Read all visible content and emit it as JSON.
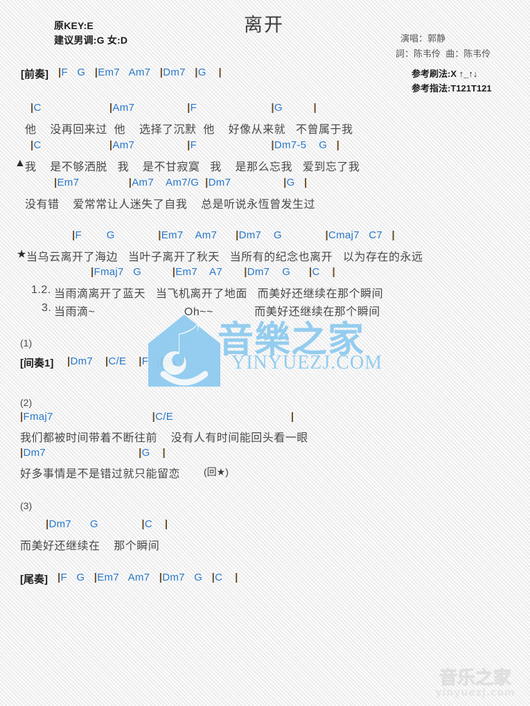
{
  "document": {
    "title": "离开",
    "key_info": {
      "original_key": "原KEY:E",
      "suggested_key": "建议男调:G 女:D"
    },
    "credits": {
      "singer": "演唱：郭静",
      "writers": "詞：陈韦伶  曲：陈韦伶"
    },
    "play_info": {
      "strum": "参考刷法:X ↑_↑↓",
      "fingering": "参考指法:T121T121"
    }
  },
  "sections": {
    "intro": {
      "tag": "[前奏]",
      "chords": "|F   G   |Em7   Am7   |Dm7   |G    |"
    },
    "verse1": {
      "line1_chords": "|C                      |Am7                 |F                        |G          |",
      "line1_lyrics": "他    没再回来过  他    选择了沉默  他    好像从来就   不曾属于我",
      "line2_chords": "|C                      |Am7                 |F                        |Dm7-5    G   |",
      "line2_marker": "▲",
      "line2_lyrics": "我    是不够洒脱   我    是不甘寂寞   我    是那么忘我   爱到忘了我",
      "line3_chords": "|Em7                |Am7    Am7/G  |Dm7                 |G   |",
      "line3_lyrics": "没有错    爱常常让人迷失了自我    总是听说永恆曾发生过"
    },
    "chorus": {
      "line1_chords": "|F        G              |Em7    Am7      |Dm7    G              |Cmaj7   C7   |",
      "line1_marker": "★",
      "line1_lyrics": "当乌云离开了海边   当叶子离开了秋天   当所有的纪念也离开   以为存在的永远",
      "line2_chords": "|Fmaj7   G          |Em7    A7       |Dm7    G      |C    |",
      "line2_prefix": "1.2.",
      "line2_lyrics": "当雨滴离开了蓝天   当飞机离开了地面   而美好还继续在那个瞬间",
      "line3_prefix": "3.",
      "line3_lyrics": "当雨滴~                          Oh~~            而美好还继续在那个瞬间"
    },
    "part1": {
      "number": "(1)",
      "tag": "[间奏1]",
      "chords": "|Dm7    |C/E    |F    |G    |",
      "repeat_note": "(回▲)"
    },
    "part2": {
      "number": "(2)",
      "line1_chords": "|Fmaj7                                |C/E                                      |",
      "line1_lyrics": "我们都被时间带着不断往前    没有人有时间能回头看一眼",
      "line2_chords": "|Dm7                              |G    |",
      "line2_lyrics": "好多事情是不是错过就只能留恋",
      "line2_note": "(回★)"
    },
    "part3": {
      "number": "(3)",
      "chords": "|Dm7      G              |C    |",
      "lyrics": "而美好还继续在    那个瞬间"
    },
    "outro": {
      "tag": "[尾奏]",
      "chords": "|F   G   |Em7   Am7   |Dm7   G   |C    |"
    }
  },
  "watermarks": {
    "center_text": "音樂之家",
    "center_url": "YINYUEZJ.COM",
    "bottom_text": "音乐之家",
    "bottom_url": "yinyuezj.com"
  },
  "colors": {
    "chord": "#2878c8",
    "barline": "#6b4a23",
    "lyric": "#484848",
    "watermark": "#8fcbef"
  }
}
